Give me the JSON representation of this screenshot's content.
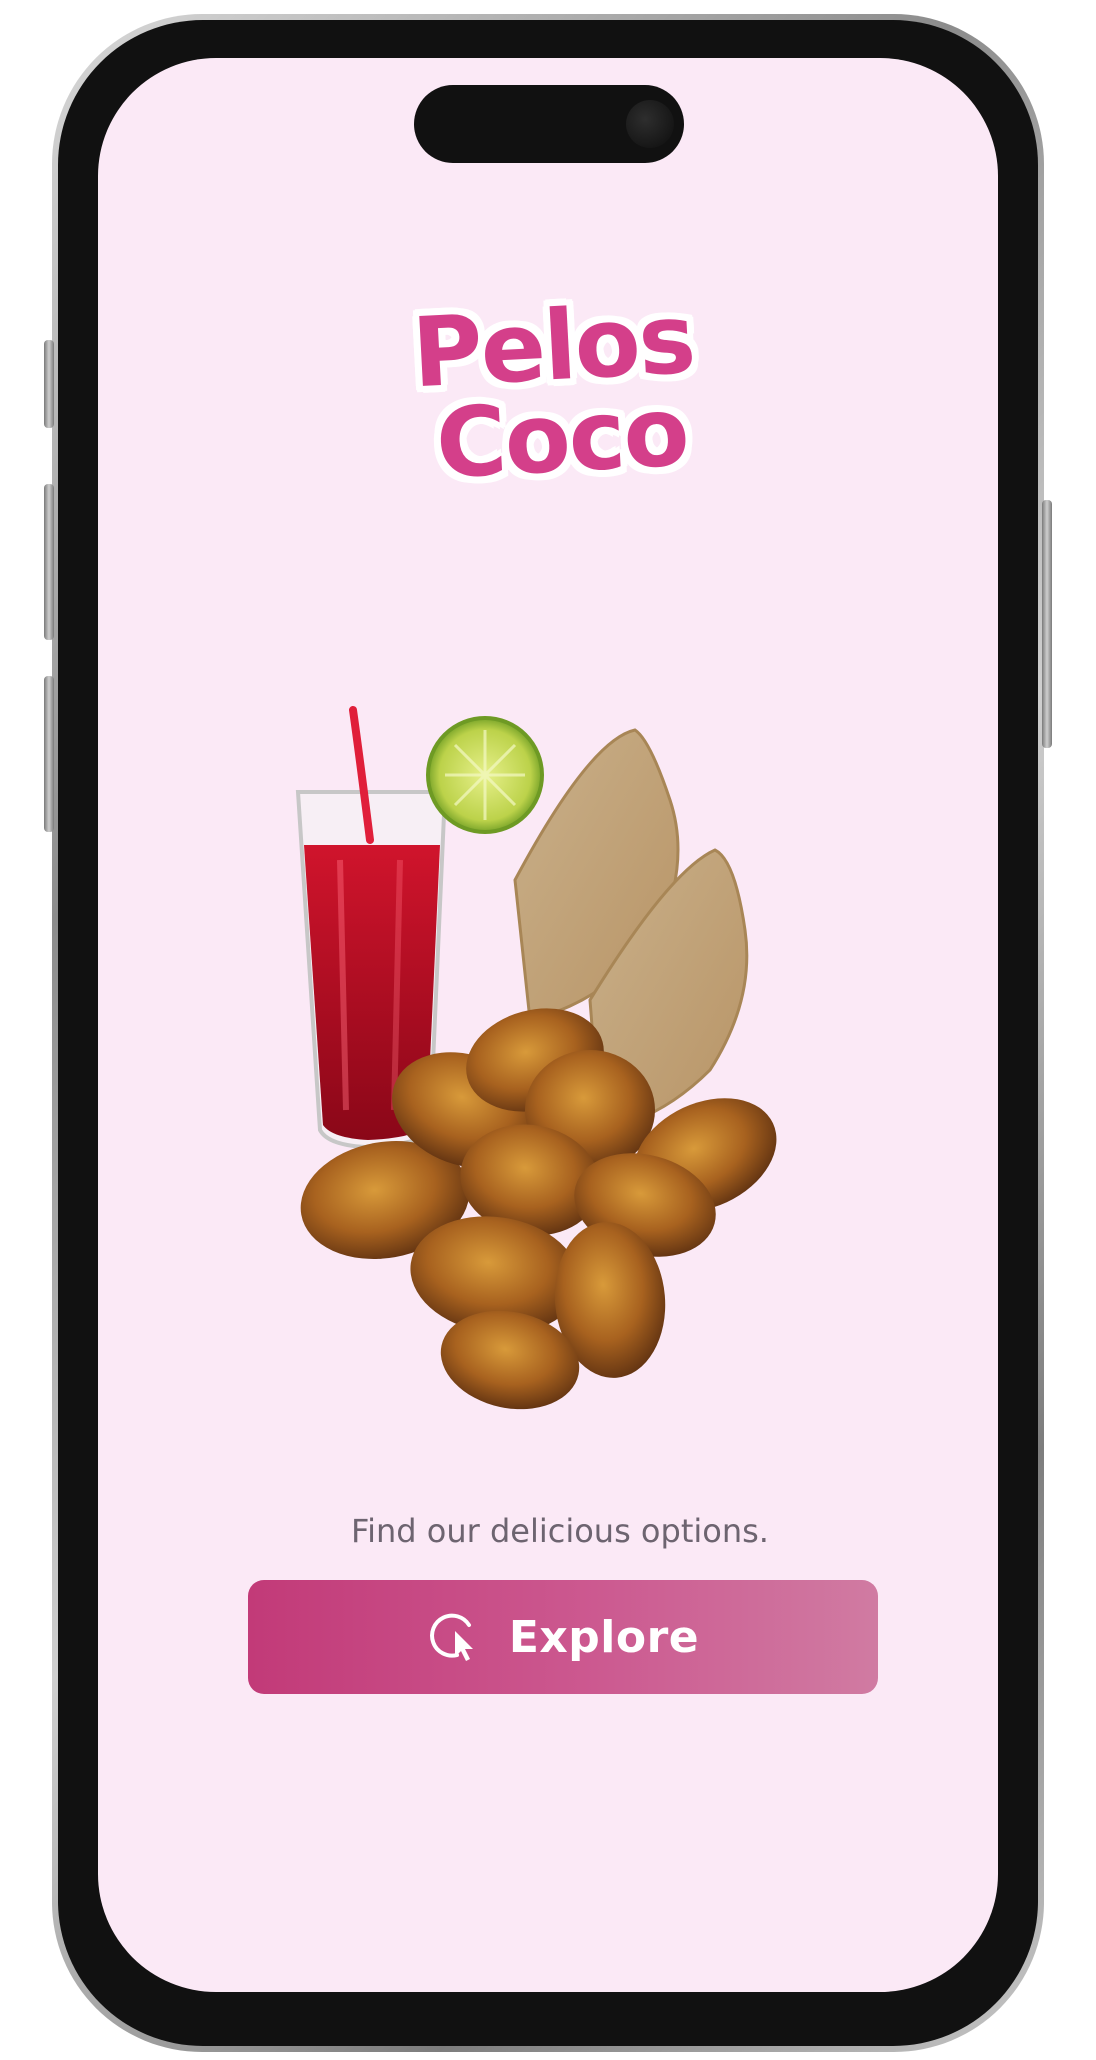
{
  "app": {
    "logo_line1": "Pelos",
    "logo_line2": "Coco"
  },
  "hero": {
    "image": "food-illustration"
  },
  "welcome": {
    "tagline": "Find our delicious options.",
    "explore_label": "Explore",
    "explore_icon": "cursor-click-icon"
  },
  "colors": {
    "screen_bg": "#fbe9f6",
    "brand_pink": "#d43f8a",
    "button_start": "#c23a78",
    "button_end": "#d07ba2"
  }
}
